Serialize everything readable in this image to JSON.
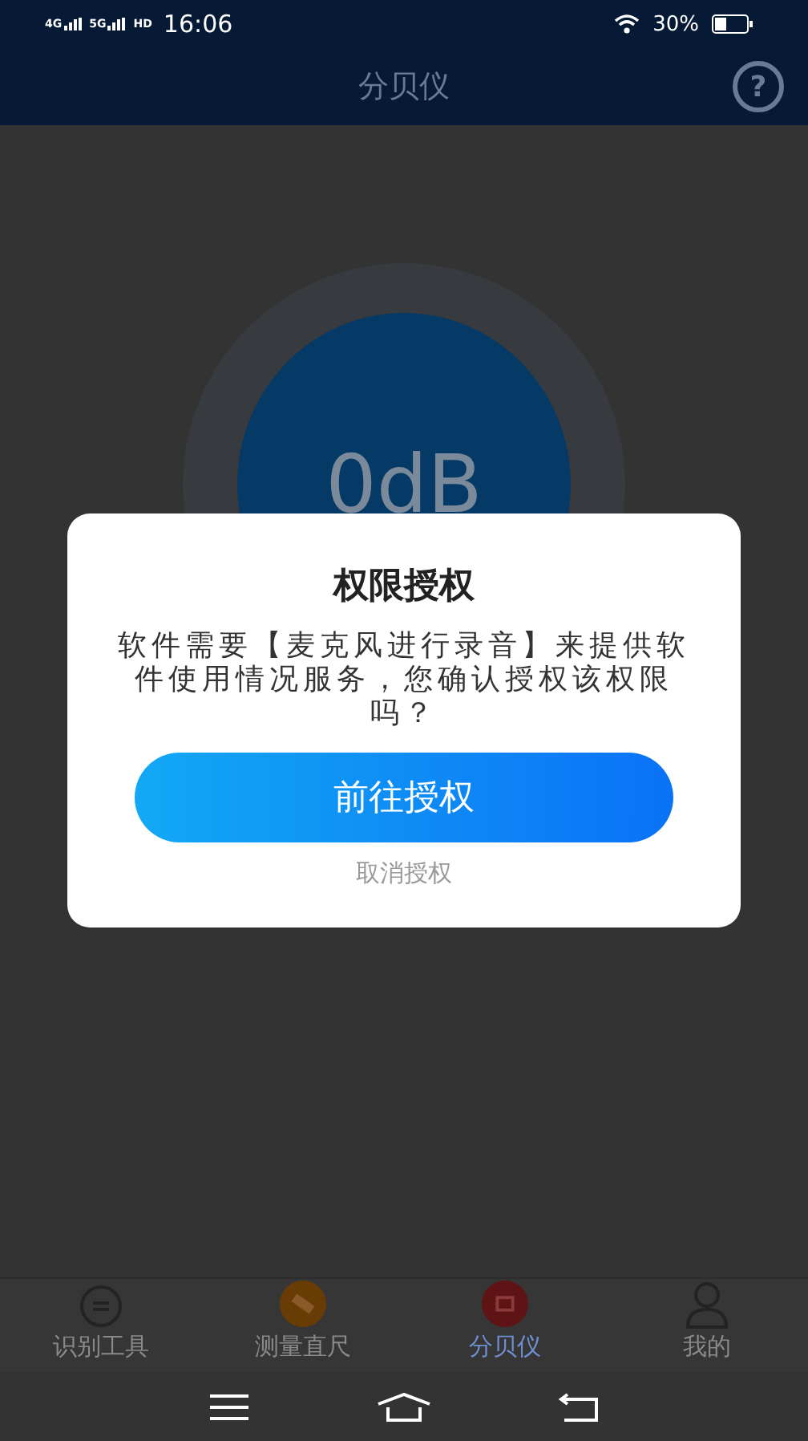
{
  "status_bar": {
    "network_labels": [
      "4G",
      "5G",
      "HD"
    ],
    "time": "16:06",
    "battery": "30%"
  },
  "header": {
    "title": "分贝仪",
    "help_icon": "?"
  },
  "meter": {
    "reading": "0dB"
  },
  "dialog": {
    "title": "权限授权",
    "message": "软件需要【麦克风进行录音】来提供软件使用情况服务，您确认授权该权限吗？",
    "confirm_button": "前往授权",
    "cancel_button": "取消授权"
  },
  "tabs": [
    {
      "label": "识别工具",
      "kind": "scan",
      "selected": false
    },
    {
      "label": "测量直尺",
      "kind": "ruler",
      "selected": false
    },
    {
      "label": "分贝仪",
      "kind": "meter",
      "selected": true
    },
    {
      "label": "我的",
      "kind": "person",
      "selected": false
    }
  ]
}
